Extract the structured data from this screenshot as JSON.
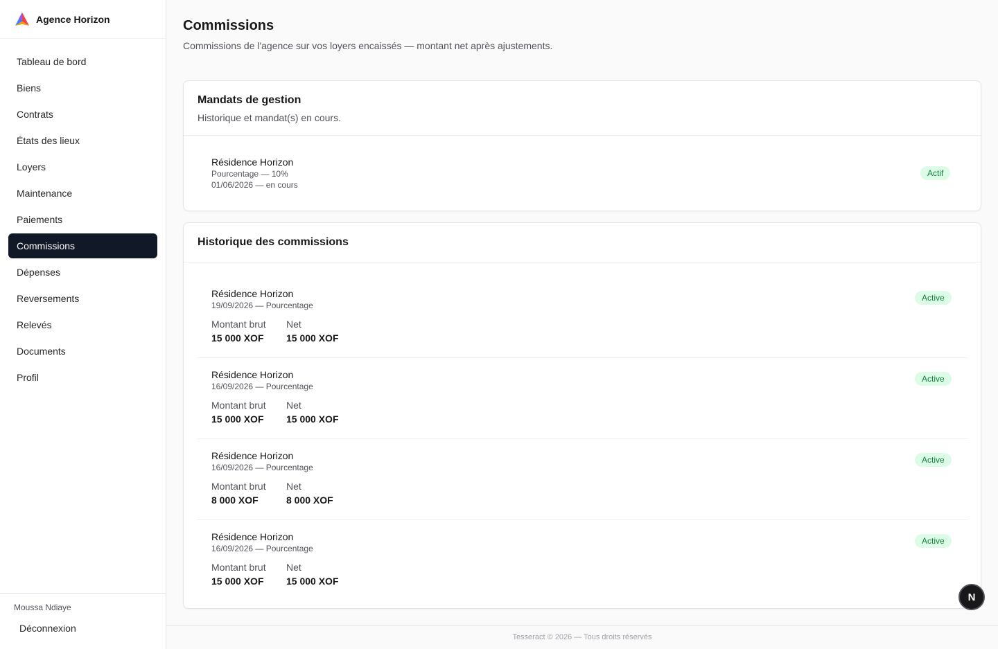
{
  "brand": {
    "name": "Agence Horizon"
  },
  "nav": {
    "items": [
      {
        "label": "Tableau de bord"
      },
      {
        "label": "Biens"
      },
      {
        "label": "Contrats"
      },
      {
        "label": "États des lieux"
      },
      {
        "label": "Loyers"
      },
      {
        "label": "Maintenance"
      },
      {
        "label": "Paiements"
      },
      {
        "label": "Commissions"
      },
      {
        "label": "Dépenses"
      },
      {
        "label": "Reversements"
      },
      {
        "label": "Relevés"
      },
      {
        "label": "Documents"
      },
      {
        "label": "Profil"
      }
    ],
    "active_index": 7
  },
  "user": {
    "name": "Moussa Ndiaye",
    "logout_label": "Déconnexion"
  },
  "page": {
    "title": "Commissions",
    "subtitle": "Commissions de l'agence sur vos loyers encaissés — montant net après ajustements."
  },
  "mandates": {
    "title": "Mandats de gestion",
    "subtitle": "Historique et mandat(s) en cours.",
    "items": [
      {
        "property": "Résidence Horizon",
        "type": "Pourcentage — 10%",
        "period": "01/06/2026 — en cours",
        "status": "Actif"
      }
    ]
  },
  "history": {
    "title": "Historique des commissions",
    "gross_label": "Montant brut",
    "net_label": "Net",
    "rows": [
      {
        "property": "Résidence Horizon",
        "meta": "19/09/2026 — Pourcentage",
        "gross": "15 000 XOF",
        "net": "15 000 XOF",
        "status": "Active"
      },
      {
        "property": "Résidence Horizon",
        "meta": "16/09/2026 — Pourcentage",
        "gross": "15 000 XOF",
        "net": "15 000 XOF",
        "status": "Active"
      },
      {
        "property": "Résidence Horizon",
        "meta": "16/09/2026 — Pourcentage",
        "gross": "8 000 XOF",
        "net": "8 000 XOF",
        "status": "Active"
      },
      {
        "property": "Résidence Horizon",
        "meta": "16/09/2026 — Pourcentage",
        "gross": "15 000 XOF",
        "net": "15 000 XOF",
        "status": "Active"
      }
    ]
  },
  "footer": {
    "text": "Tesseract © 2026 — Tous droits réservés"
  },
  "fab": {
    "letter": "N"
  },
  "colors": {
    "sidebar_active": "#111827",
    "badge_bg": "#dcfce7",
    "badge_text": "#15803d"
  }
}
